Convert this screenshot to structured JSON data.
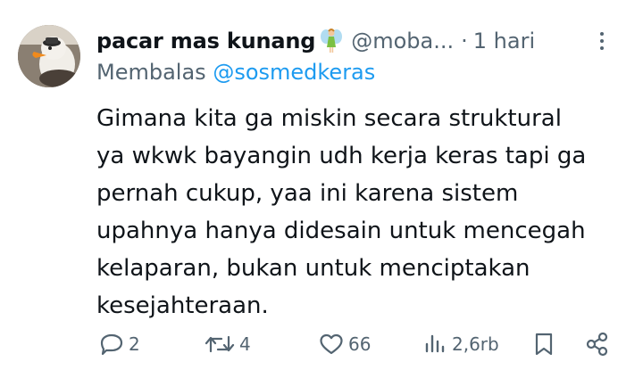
{
  "tweet": {
    "display_name": "pacar mas kunang",
    "name_emoji": "fairy-emoji",
    "handle": "@moba...",
    "separator": "·",
    "time": "1 hari",
    "replying_prefix": "Membalas",
    "replying_to": "@sosmedkeras",
    "text_lines": [
      "Gimana kita ga miskin secara struktural",
      "ya wkwk bayangin udh kerja keras tapi ga",
      "pernah cukup, yaa ini karena sistem",
      "upahnya hanya didesain untuk mencegah",
      "kelaparan, bukan untuk menciptakan",
      "kesejahteraan."
    ]
  },
  "actions": {
    "replies": "2",
    "reposts": "4",
    "likes": "66",
    "views": "2,6rb"
  },
  "colors": {
    "text": "#0f1419",
    "secondary": "#536471",
    "link": "#1d9bf0"
  }
}
